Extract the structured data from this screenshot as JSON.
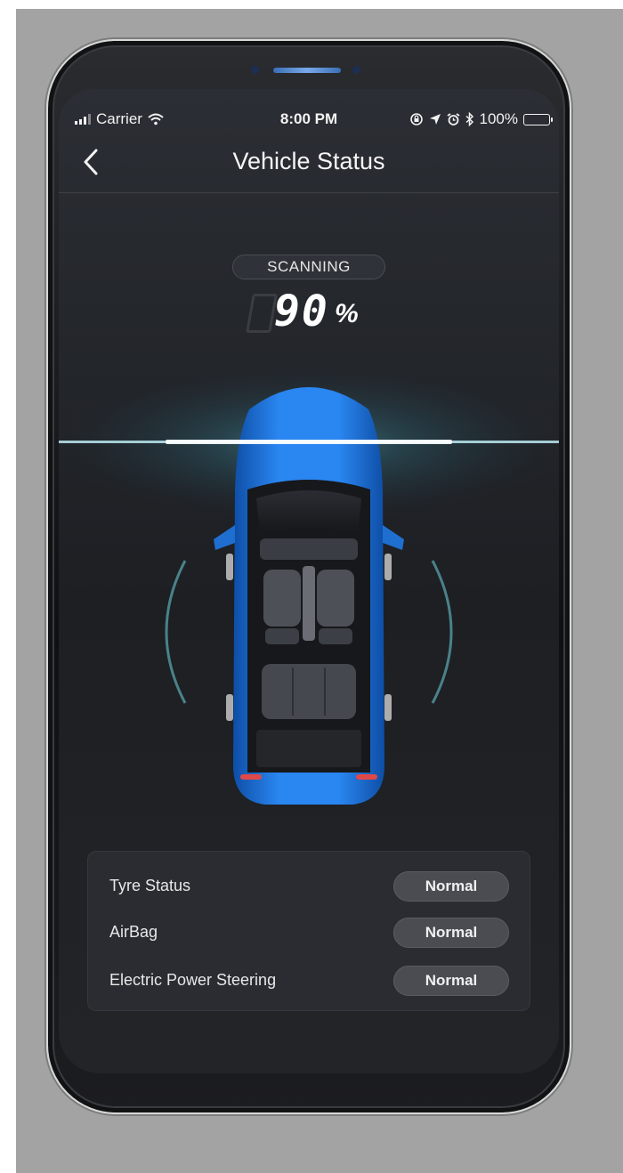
{
  "status_bar": {
    "carrier": "Carrier",
    "time": "8:00 PM",
    "battery": "100%"
  },
  "nav": {
    "title": "Vehicle Status"
  },
  "scan": {
    "label": "SCANNING",
    "percent": "90",
    "percent_sign": "%"
  },
  "status_items": [
    {
      "label": "Tyre Status",
      "value": "Normal"
    },
    {
      "label": "AirBag",
      "value": "Normal"
    },
    {
      "label": "Electric Power Steering",
      "value": "Normal"
    }
  ],
  "colors": {
    "car_body": "#1f6fd0",
    "scan_glow": "#7fe6f2",
    "screen_bg": "#1d1f23"
  },
  "icons": [
    "back-chevron-icon",
    "wifi-icon",
    "lock-rotation-icon",
    "location-arrow-icon",
    "alarm-icon",
    "bluetooth-icon",
    "battery-icon"
  ]
}
